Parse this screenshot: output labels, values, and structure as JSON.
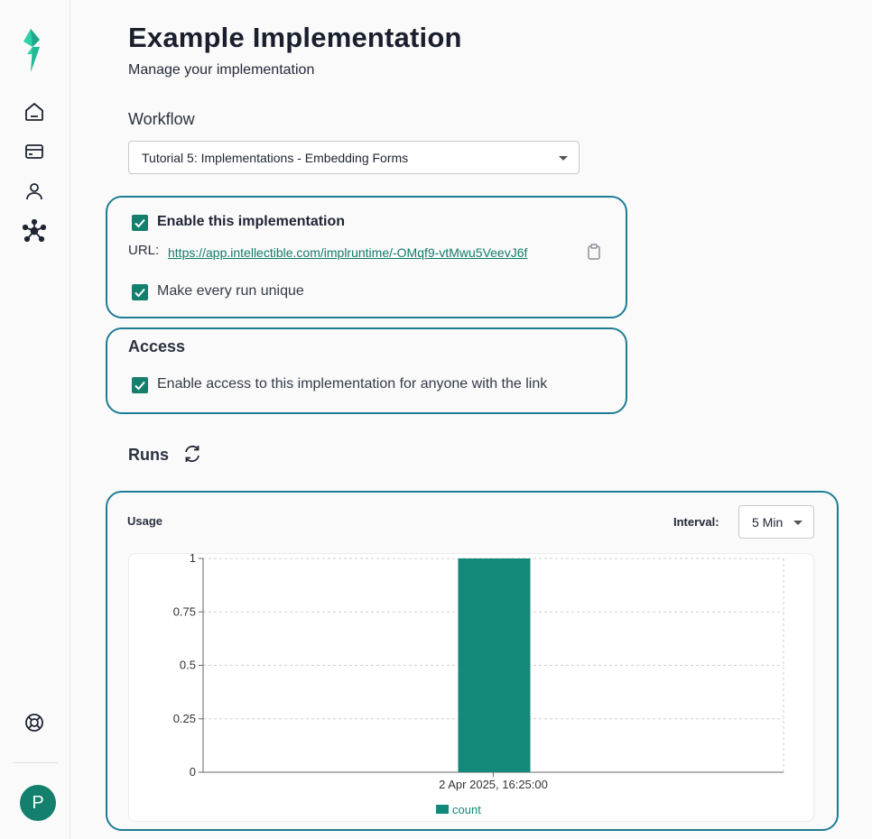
{
  "page": {
    "title": "Example Implementation",
    "subtitle": "Manage your implementation"
  },
  "workflow": {
    "label": "Workflow",
    "selected": "Tutorial 5: Implementations - Embedding Forms"
  },
  "implementation": {
    "enable_label": "Enable this implementation",
    "enabled": true,
    "url_label": "URL:",
    "url": "https://app.intellectible.com/implruntime/-OMqf9-vtMwu5VeevJ6f",
    "unique_label": "Make every run unique",
    "unique": true
  },
  "access": {
    "title": "Access",
    "link_label": "Enable access to this implementation for anyone with the link",
    "enabled": true
  },
  "runs": {
    "title": "Runs",
    "usage_label": "Usage",
    "interval_label": "Interval:",
    "interval_value": "5 Min"
  },
  "user": {
    "initial": "P"
  },
  "colors": {
    "accent": "#12806c",
    "card_border": "#1d7c94",
    "bar": "#12897a"
  },
  "chart_data": {
    "type": "bar",
    "categories": [
      "2 Apr 2025, 16:25:00"
    ],
    "series": [
      {
        "name": "count",
        "values": [
          1
        ]
      }
    ],
    "ylim": [
      0,
      1
    ],
    "yticks": [
      "0",
      "0.25",
      "0.5",
      "0.75",
      "1"
    ],
    "grid": true,
    "legend": "bottom"
  }
}
